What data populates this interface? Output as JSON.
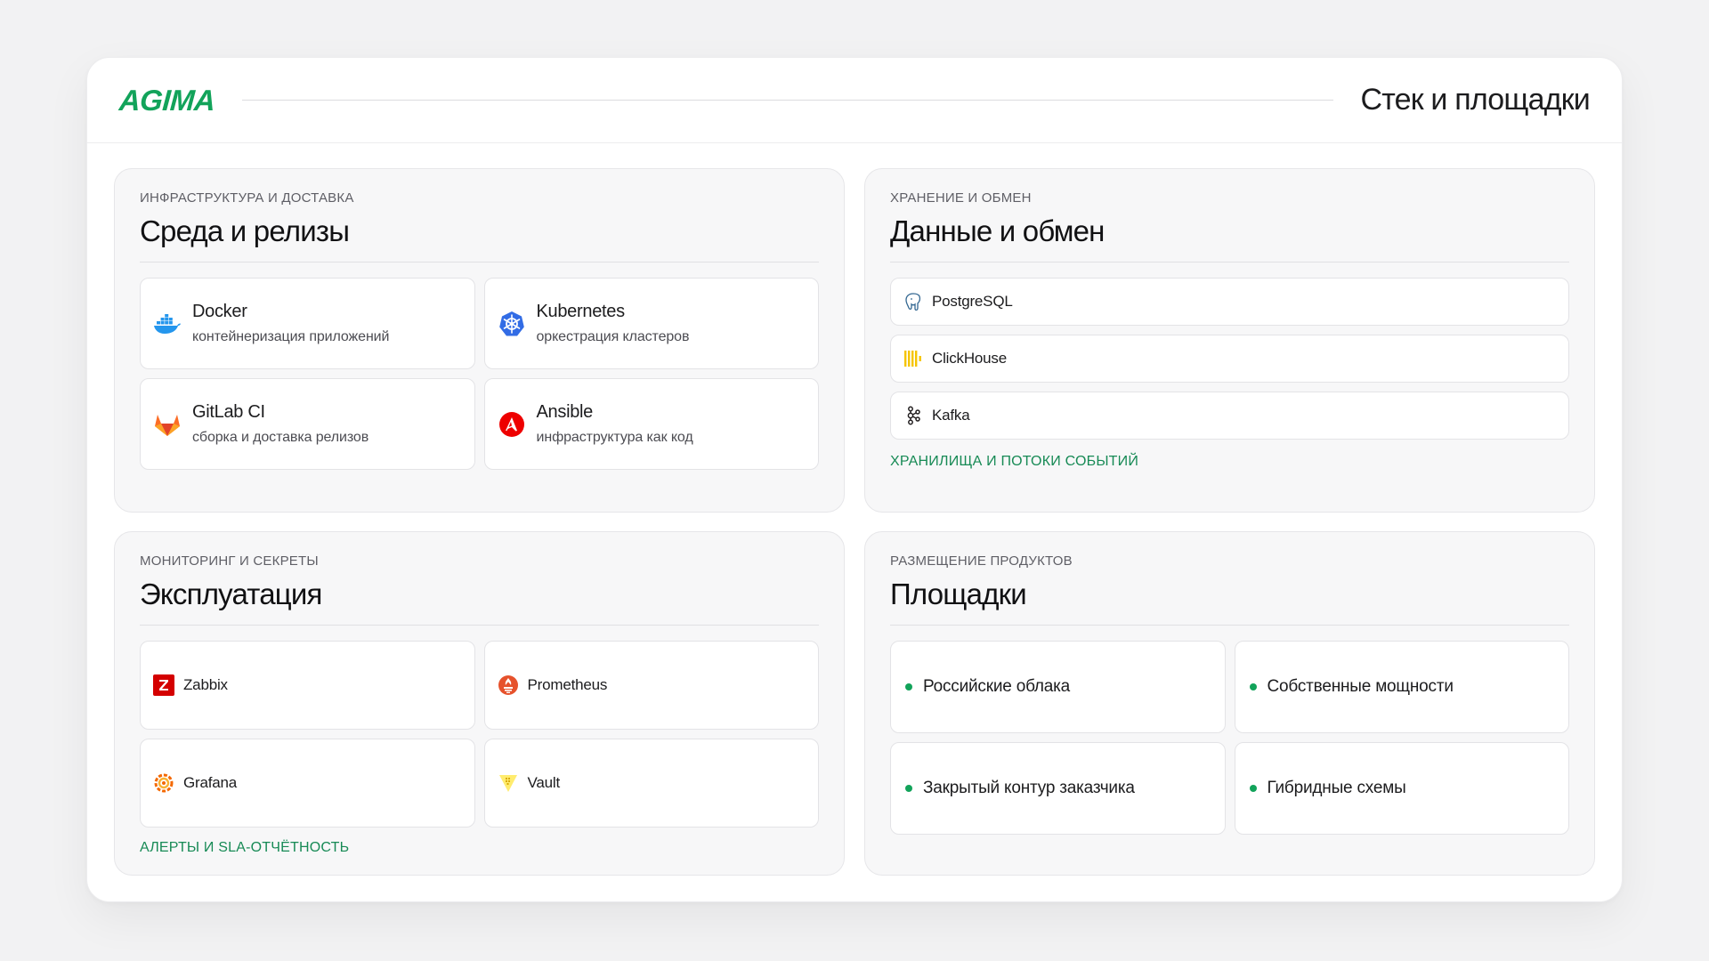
{
  "header": {
    "logo": "AGIMA",
    "title": "Стек и площадки"
  },
  "colors": {
    "accent": "#12a35a",
    "link": "#178a55"
  },
  "panels": {
    "infra": {
      "eyebrow": "Инфраструктура и доставка",
      "title": "Среда и релизы",
      "tiles": [
        {
          "name": "Docker",
          "desc": "контейнеризация приложений",
          "icon": "docker-icon"
        },
        {
          "name": "Kubernetes",
          "desc": "оркестрация кластеров",
          "icon": "kubernetes-icon"
        },
        {
          "name": "GitLab CI",
          "desc": "сборка и доставка релизов",
          "icon": "gitlab-icon"
        },
        {
          "name": "Ansible",
          "desc": "инфраструктура как код",
          "icon": "ansible-icon"
        }
      ]
    },
    "data": {
      "eyebrow": "Хранение и обмен",
      "title": "Данные и обмен",
      "items": [
        {
          "name": "PostgreSQL",
          "icon": "postgresql-icon"
        },
        {
          "name": "ClickHouse",
          "icon": "clickhouse-icon"
        },
        {
          "name": "Kafka",
          "icon": "kafka-icon"
        }
      ],
      "footer": "Хранилища и потоки событий"
    },
    "ops": {
      "eyebrow": "Мониторинг и секреты",
      "title": "Эксплуатация",
      "tiles": [
        {
          "name": "Zabbix",
          "icon": "zabbix-icon"
        },
        {
          "name": "Prometheus",
          "icon": "prometheus-icon"
        },
        {
          "name": "Grafana",
          "icon": "grafana-icon"
        },
        {
          "name": "Vault",
          "icon": "vault-icon"
        }
      ],
      "footer": "Алерты и SLA-отчётность"
    },
    "hosting": {
      "eyebrow": "Размещение продуктов",
      "title": "Площадки",
      "tiles": [
        {
          "name": "Российские облака"
        },
        {
          "name": "Собственные мощности"
        },
        {
          "name": "Закрытый контур заказчика"
        },
        {
          "name": "Гибридные схемы"
        }
      ]
    }
  }
}
